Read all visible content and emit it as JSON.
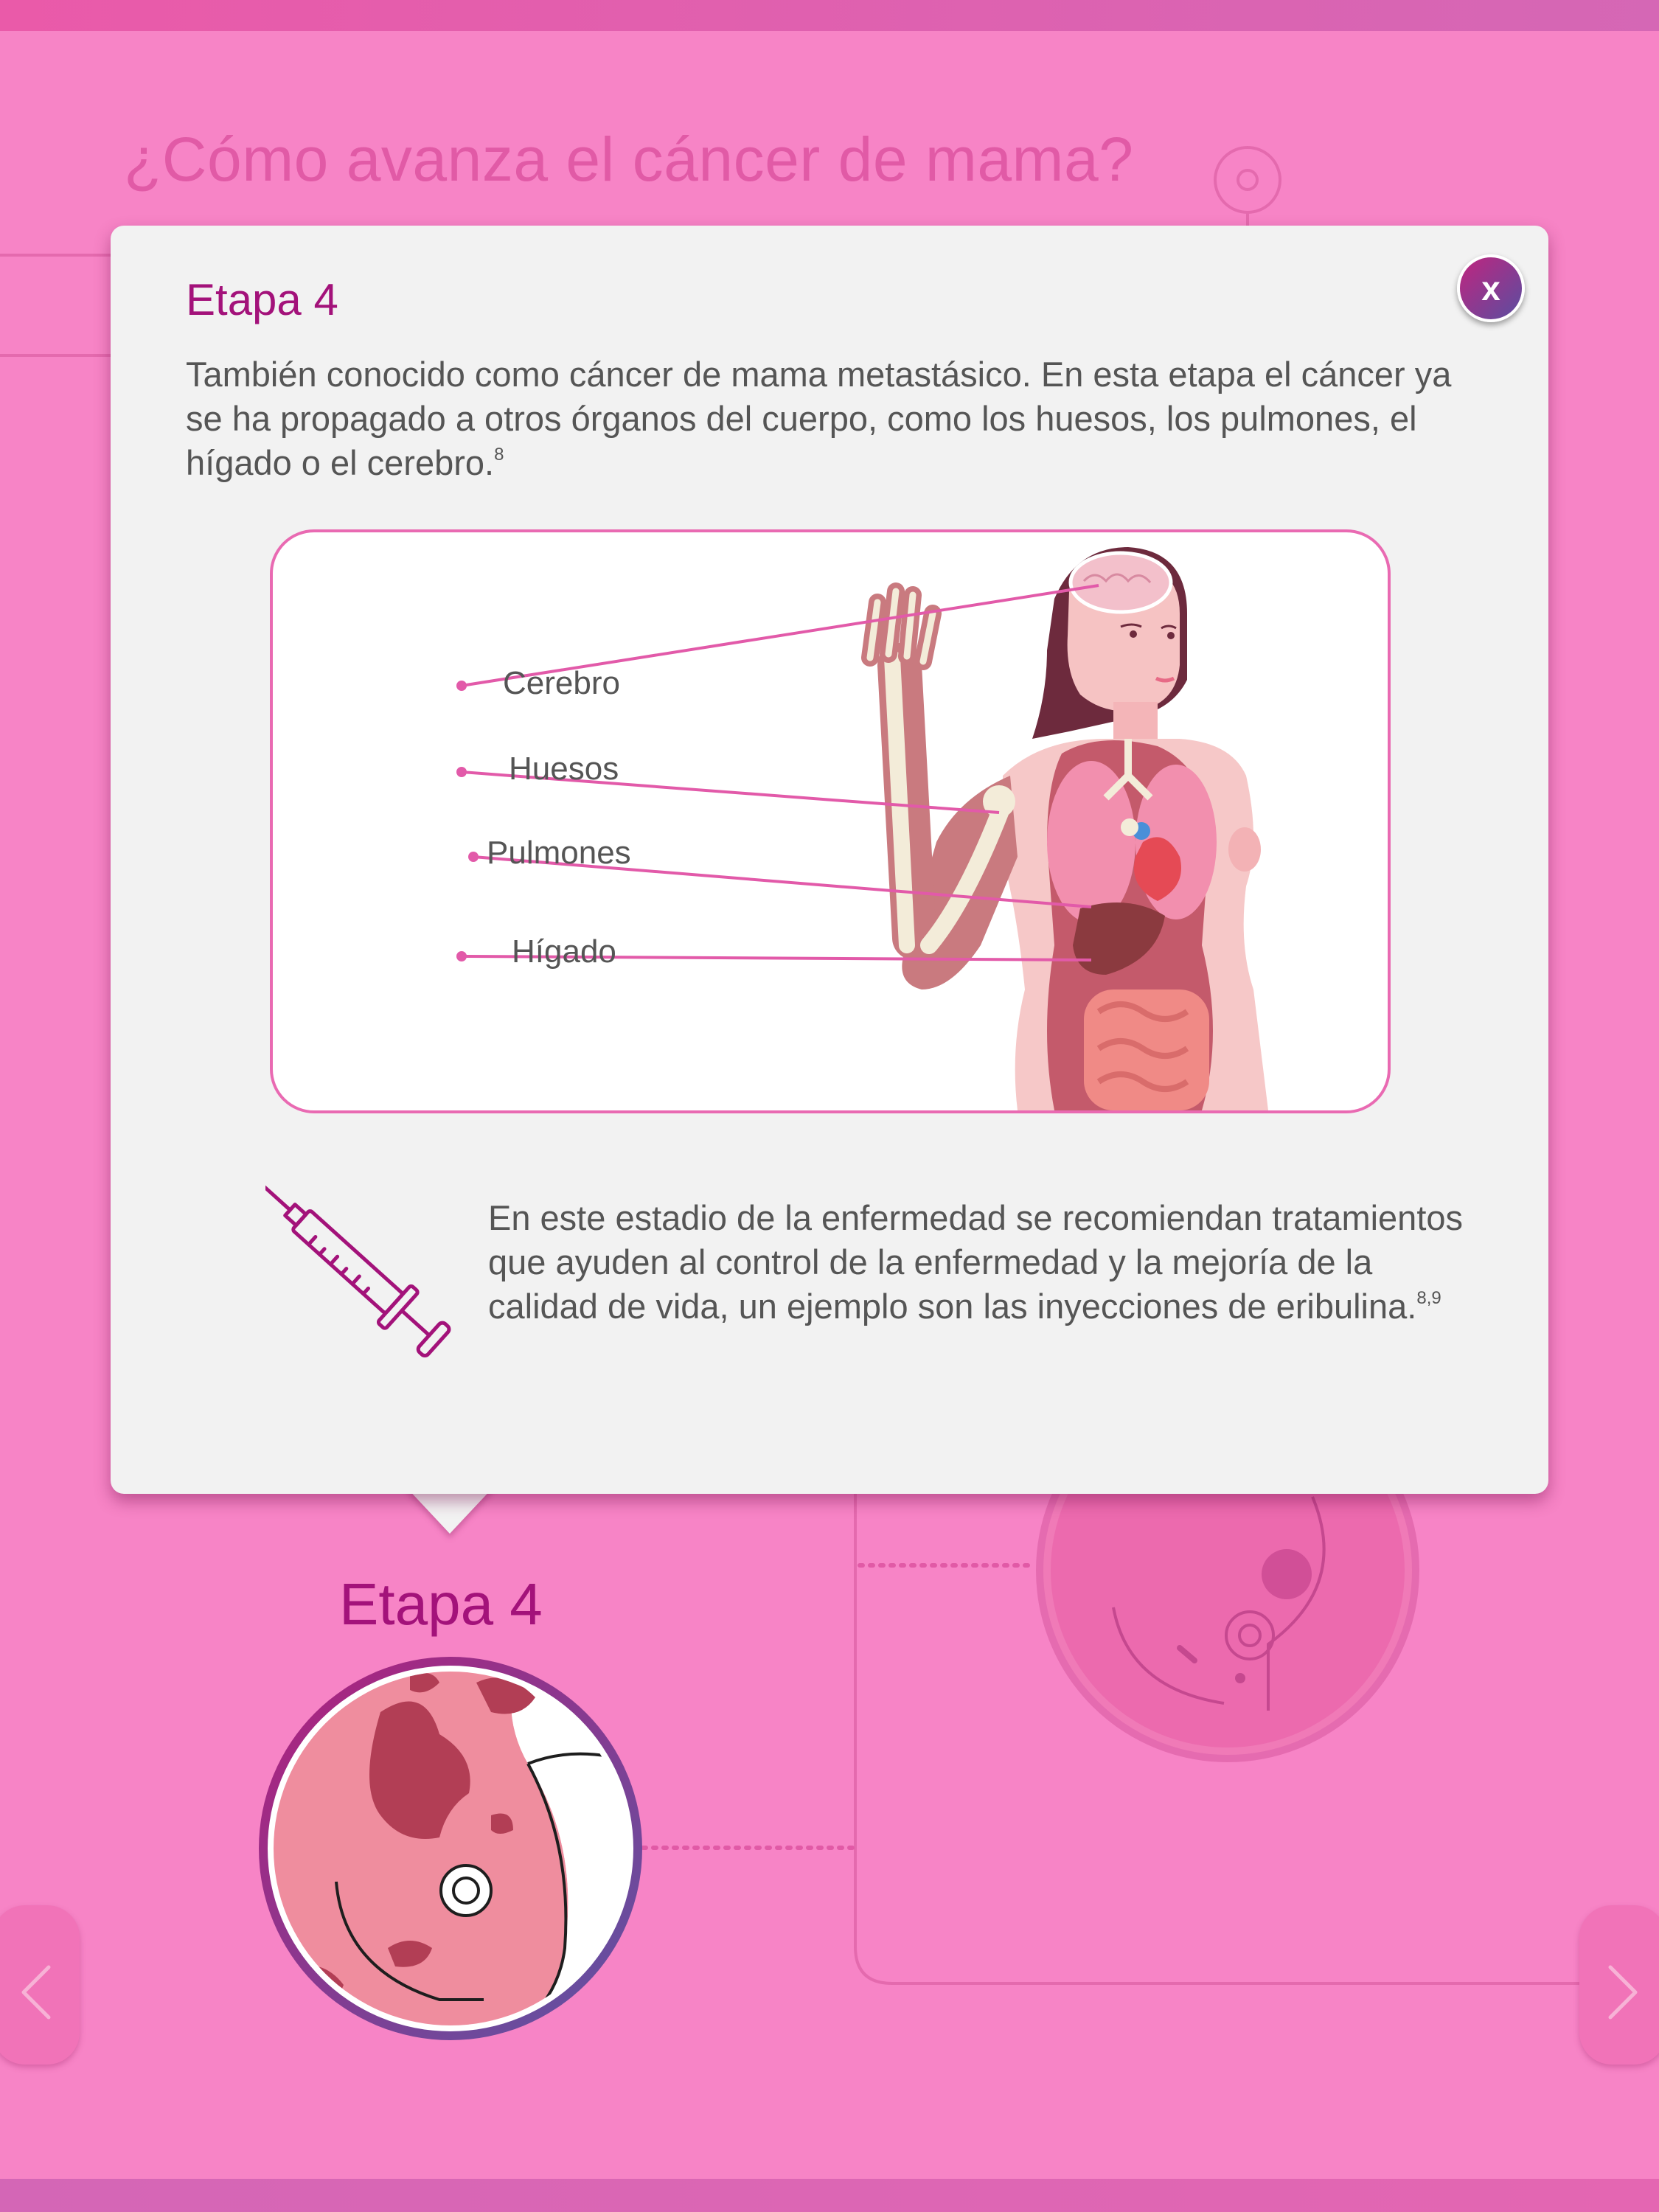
{
  "header": {
    "title": "¿Cómo avanza el cáncer de mama?"
  },
  "popup": {
    "close_label": "x",
    "heading": "Etapa 4",
    "description": "También conocido como cáncer de mama metastásico. En esta etapa el cáncer ya se ha propagado a otros órganos del cuerpo, como los huesos, los pulmones, el hígado o el cerebro.",
    "description_ref": "8",
    "organs": [
      "Cerebro",
      "Huesos",
      "Pulmones",
      "Hígado"
    ],
    "treatment_text": "En este estadio de la enfermedad se recomiendan tratamientos que ayuden al control de la enfermedad y la mejoría de la calidad de vida, un ejemplo son las inyecciones de eribulina.",
    "treatment_ref": "8,9"
  },
  "stage": {
    "label": "Etapa 4"
  },
  "nav": {
    "prev_icon": "chevron-left-icon",
    "next_icon": "chevron-right-icon"
  },
  "colors": {
    "background": "#f784c6",
    "accent": "#a3127a",
    "popup": "#f2f2f2",
    "line": "#e96ab2"
  }
}
